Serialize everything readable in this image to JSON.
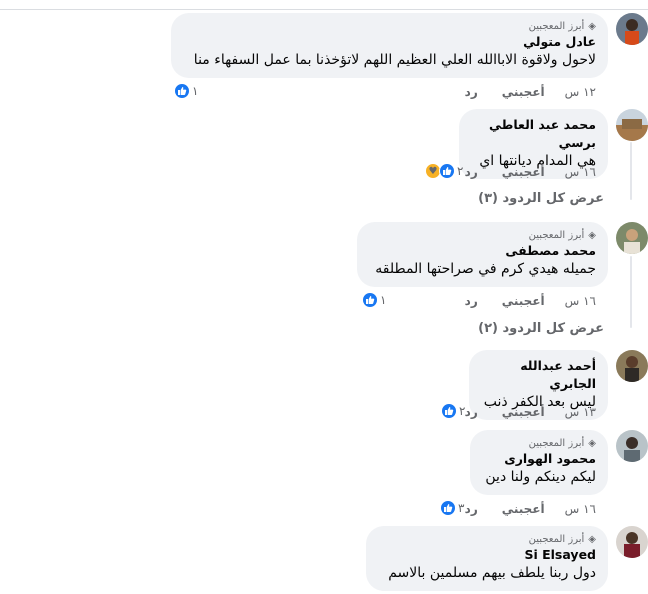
{
  "top_fan_label": "أبرز المعجبين",
  "reply_label": "رد",
  "like_label": "أعجبني",
  "comments": [
    {
      "author": "عادل متولي",
      "text": "لاحول ولاقوة الاباالله العلي العظيم اللهم لاتؤخذنا بما عمل السفهاء منا",
      "time": "١٢ س",
      "reactions": "١",
      "top_fan": true
    },
    {
      "author": "محمد عبد العاطي برسي",
      "text": "هي المدام ديانتها اي",
      "time": "١٦ س",
      "reactions": "٢",
      "top_fan": false,
      "view_replies": "عرض كل الردود (٣)"
    },
    {
      "author": "محمد مصطفى",
      "text": "جميله هيدي كرم في صراحتها المطلقه",
      "time": "١٦ س",
      "reactions": "١",
      "top_fan": true,
      "view_replies": "عرض كل الردود (٢)"
    },
    {
      "author": "أحمد عبدالله الجابري",
      "text": "ليس بعد الكفر ذنب",
      "time": "١٣ س",
      "reactions": "٢",
      "top_fan": false
    },
    {
      "author": "محمود الهوارى",
      "text": "ليكم دينكم ولنا دين",
      "time": "١٦ س",
      "reactions": "٣",
      "top_fan": true
    },
    {
      "author": "Si Elsayed",
      "text": "دول ربنا يلطف بيهم مسلمين بالاسم",
      "time": "",
      "reactions": "",
      "top_fan": true
    }
  ],
  "colors": {
    "accent": "#1877f2",
    "bubble": "#f0f2f5",
    "secondary_text": "#65676b"
  }
}
